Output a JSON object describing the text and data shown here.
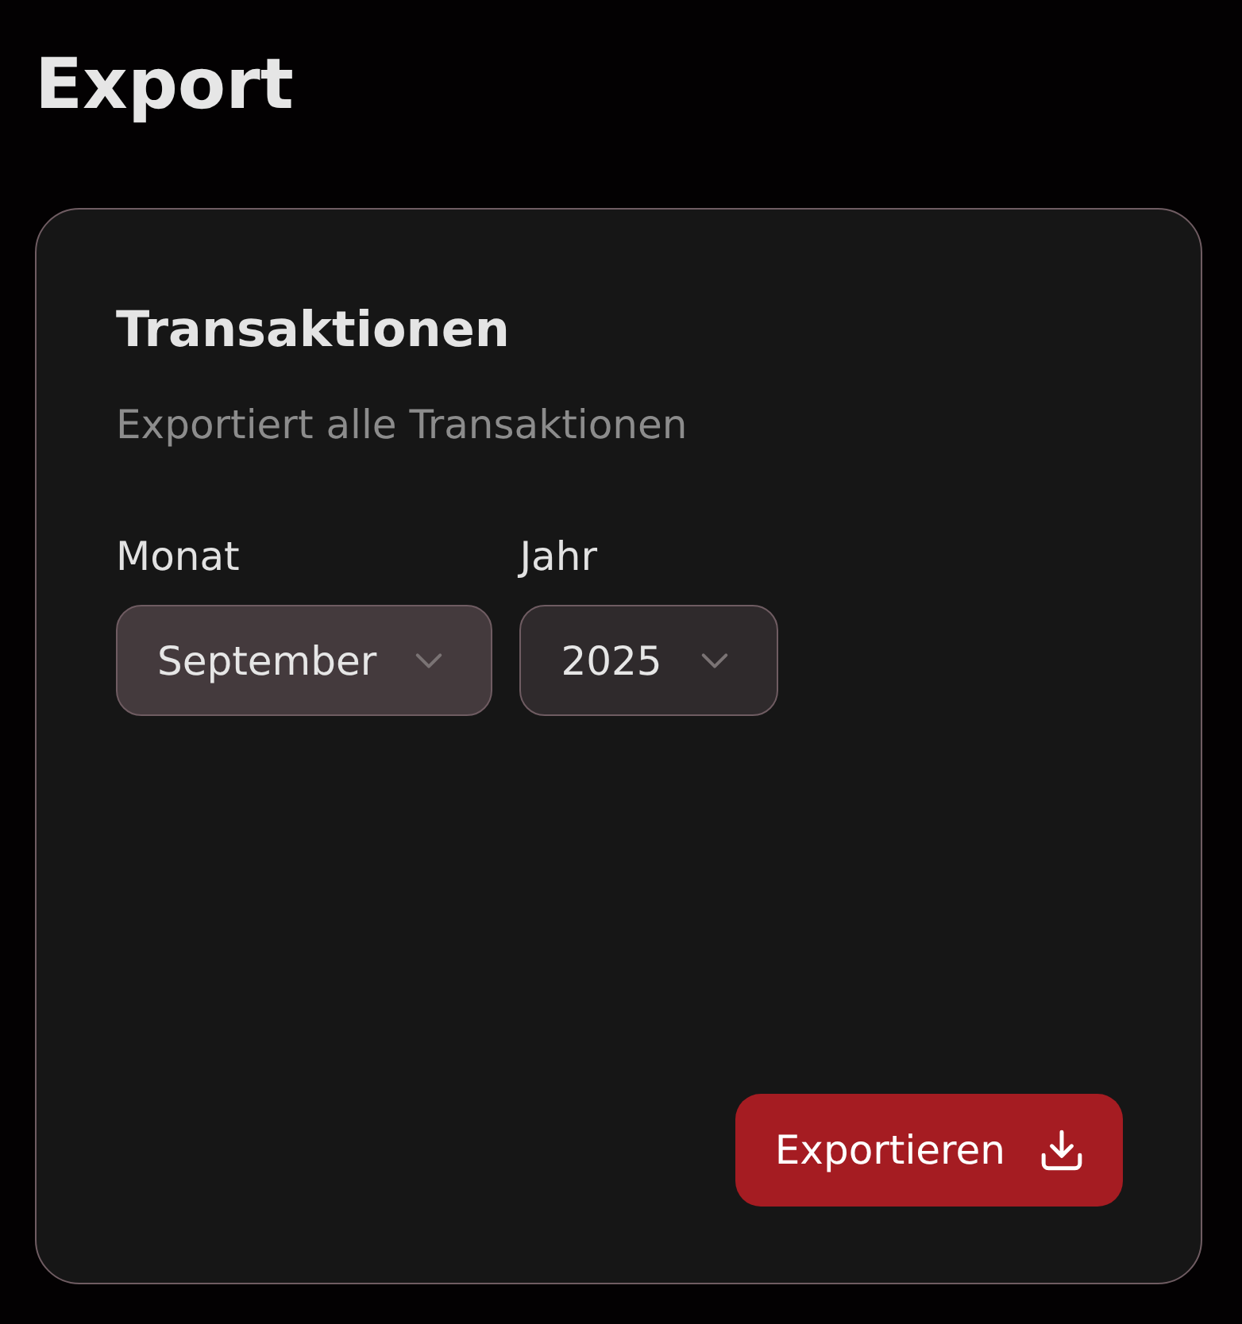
{
  "page": {
    "title": "Export"
  },
  "card": {
    "title": "Transaktionen",
    "description": "Exportiert alle Transaktionen",
    "selects": [
      {
        "label": "Monat",
        "value": "September",
        "highlighted": true
      },
      {
        "label": "Jahr",
        "value": "2025",
        "highlighted": false
      }
    ],
    "button": {
      "label": "Exportieren"
    }
  }
}
